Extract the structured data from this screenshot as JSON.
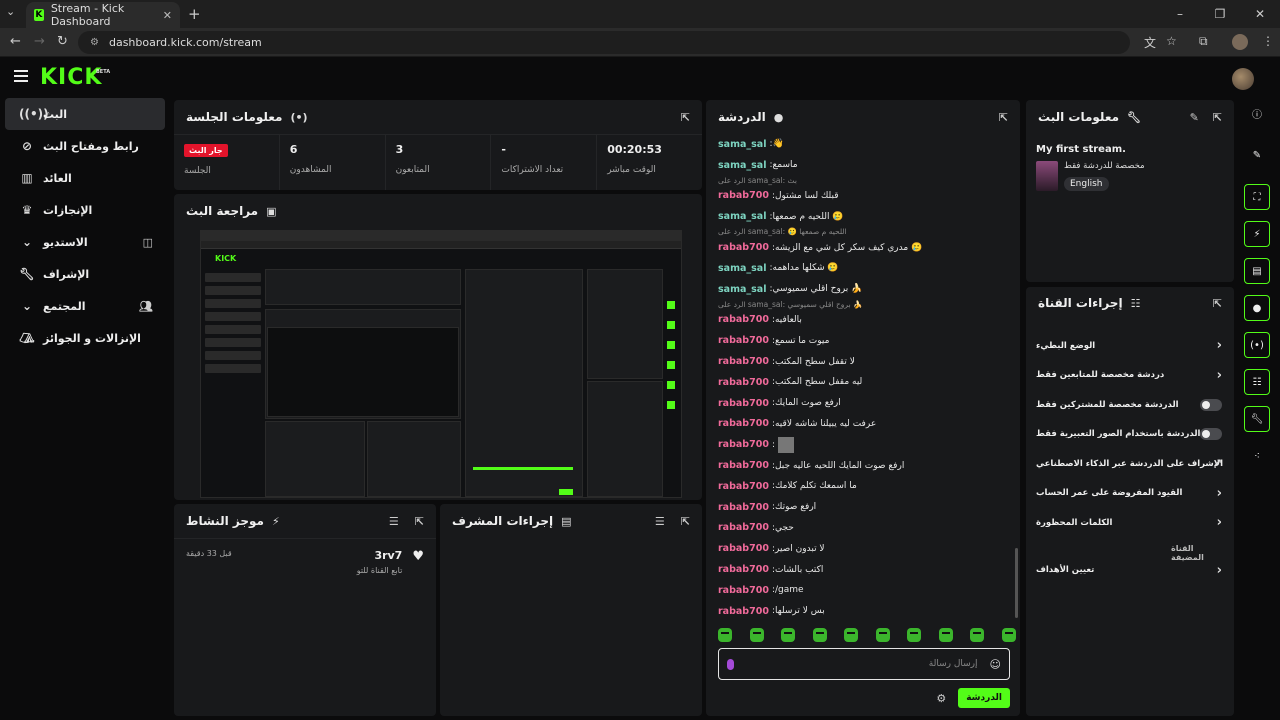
{
  "browser": {
    "tab_title": "Stream - Kick Dashboard",
    "url": "dashboard.kick.com/stream"
  },
  "site": {
    "logo": "KICK",
    "beta": "BETA"
  },
  "nav": {
    "items": [
      {
        "label": "البث",
        "icon": "broadcast-icon"
      },
      {
        "label": "رابط ومفتاح البث",
        "icon": "link-icon"
      },
      {
        "label": "العائد",
        "icon": "chart-icon"
      },
      {
        "label": "الإنجازات",
        "icon": "trophy-icon"
      },
      {
        "label": "الاستديو",
        "icon": "chevron-down-icon"
      },
      {
        "label": "الإشراف",
        "icon": "wrench-icon"
      },
      {
        "label": "المجتمع",
        "icon": "chevron-down-icon"
      },
      {
        "label": "الإنزالات و الجوائز",
        "icon": "drops-icon"
      }
    ]
  },
  "session": {
    "title": "معلومات الجلسة",
    "stats": [
      {
        "value": "جار البث",
        "label": "الجلسة"
      },
      {
        "value": "6",
        "label": "المشاهدون"
      },
      {
        "value": "3",
        "label": "المتابعون"
      },
      {
        "value": "-",
        "label": "تعداد الاشتراكات"
      },
      {
        "value": "00:20:53",
        "label": "الوقت مباشر"
      }
    ]
  },
  "preview": {
    "title": "مراجعة البث"
  },
  "activity": {
    "title": "موجز النشاط",
    "items": [
      {
        "user": "3rv7",
        "text": "تابع القناة للتو",
        "time": "قبل 33 دقيقة"
      }
    ]
  },
  "modactions": {
    "title": "إجراءات المشرف"
  },
  "chat": {
    "title": "الدردشة",
    "input_placeholder": "إرسال رسالة",
    "send_label": "الدردشة",
    "messages": [
      {
        "reply": "",
        "user": "sama_sal",
        "color": "teal",
        "text": "👋"
      },
      {
        "reply": "",
        "user": "sama_sal",
        "color": "teal",
        "text": "ماسمع"
      },
      {
        "reply": "الرد على sama_sal: بث",
        "user": "rabab700",
        "color": "pink",
        "text": "قبلك لسا مشتول"
      },
      {
        "reply": "",
        "user": "sama_sal",
        "color": "teal",
        "text": "اللحيه م صمعها 🥲"
      },
      {
        "reply": "الرد على sama_sal: 🥲 اللحيه م صمعها",
        "user": "rabab700",
        "color": "pink",
        "text": "مدري كيف سكر كل شي مع الزيشه 🥲"
      },
      {
        "reply": "",
        "user": "sama_sal",
        "color": "teal",
        "text": "شكلها مداهمه 🥲"
      },
      {
        "reply": "",
        "user": "sama_sal",
        "color": "teal",
        "text": "بروح اقلي سميوسي 🍌"
      },
      {
        "reply": "الرد على sama_sal: بروح اقلي سميوسي 🍌",
        "user": "rabab700",
        "color": "pink",
        "text": "بالعافيه"
      },
      {
        "reply": "",
        "user": "rabab700",
        "color": "pink",
        "text": "ميوت ما تسمع"
      },
      {
        "reply": "",
        "user": "rabab700",
        "color": "pink",
        "text": "لا تقفل سطح المكتب"
      },
      {
        "reply": "",
        "user": "rabab700",
        "color": "pink",
        "text": "ليه مقفل سطح المكتب"
      },
      {
        "reply": "",
        "user": "rabab700",
        "color": "pink",
        "text": "ارفع صوت المايك"
      },
      {
        "reply": "",
        "user": "rabab700",
        "color": "pink",
        "text": "عرفت ليه يبيلنا شاشه لاقيه"
      },
      {
        "reply": "",
        "user": "rabab700",
        "color": "pink",
        "text": ""
      },
      {
        "reply": "",
        "user": "rabab700",
        "color": "pink",
        "text": "ارفع صوت المايك اللحيه عاليه جبل"
      },
      {
        "reply": "",
        "user": "rabab700",
        "color": "pink",
        "text": "ما اسمعك تكلم كلامك"
      },
      {
        "reply": "",
        "user": "rabab700",
        "color": "pink",
        "text": "ارفع صوتك"
      },
      {
        "reply": "",
        "user": "rabab700",
        "color": "pink",
        "text": "حجي"
      },
      {
        "reply": "",
        "user": "rabab700",
        "color": "pink",
        "text": "لا تبدون اصير"
      },
      {
        "reply": "",
        "user": "rabab700",
        "color": "pink",
        "text": "اكتب بالشات"
      },
      {
        "reply": "",
        "user": "rabab700",
        "color": "pink",
        "text": "/game"
      },
      {
        "reply": "",
        "user": "rabab700",
        "color": "pink",
        "text": "بس لا ترسلها"
      }
    ]
  },
  "streaminfo": {
    "title": "معلومات البث",
    "stream_title": "My first stream.",
    "category": "مخصصة للدردشة فقط",
    "tag": "English"
  },
  "channelactions": {
    "title": "إجراءات القناة",
    "items": [
      {
        "label": "الوضع البطيء",
        "control": "chevron"
      },
      {
        "label": "دردشة مخصصة للمتابعين فقط",
        "control": "chevron"
      },
      {
        "label": "الدردشة مخصصة للمشتركين فقط",
        "control": "toggle"
      },
      {
        "label": "الدردشة باستخدام الصور التعبيرية فقط",
        "control": "toggle"
      },
      {
        "label": "الإشراف على الدردشة عبر الذكاء الاصطناعي",
        "control": "external"
      },
      {
        "label": "القيود المفروضة على عمر الحساب",
        "control": "chevron"
      },
      {
        "label": "الكلمات المحظورة",
        "control": "chevron"
      }
    ],
    "section": "القناة المضيفة",
    "host_item": "تعيين الأهداف"
  }
}
